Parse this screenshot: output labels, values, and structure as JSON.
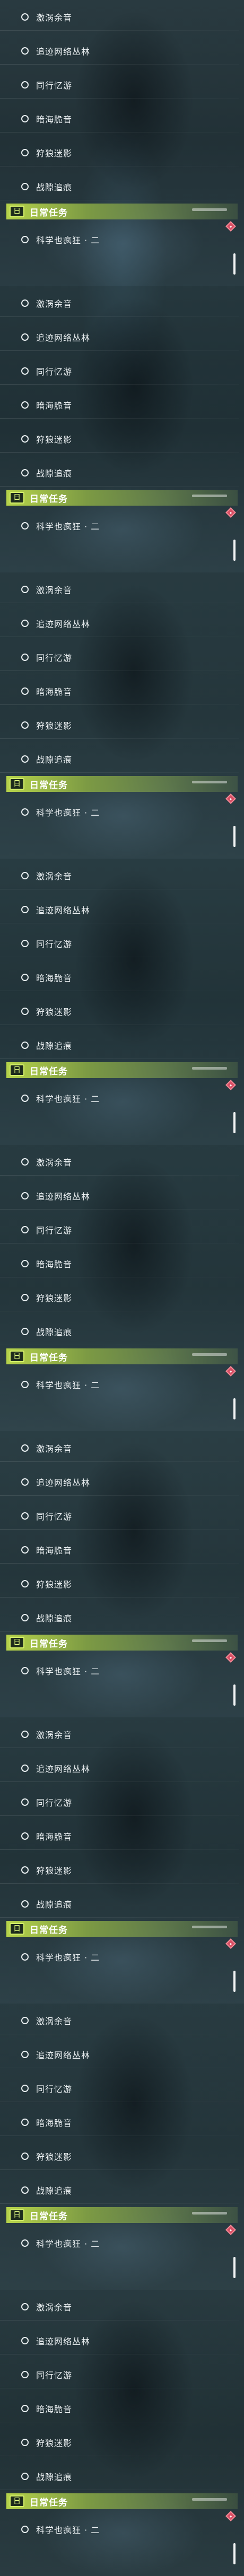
{
  "panels": [
    {
      "tasks": [
        "激涡余音",
        "追迹网络丛林",
        "同行忆游",
        "暗海脆音",
        "狩狼迷影",
        "战隙追痕"
      ],
      "section": {
        "icon_text": "日",
        "title": "日常任务"
      },
      "daily": {
        "text": "科学也疯狂 · 二"
      }
    },
    {
      "tasks": [
        "激涡余音",
        "追迹网络丛林",
        "同行忆游",
        "暗海脆音",
        "狩狼迷影",
        "战隙追痕"
      ],
      "section": {
        "icon_text": "日",
        "title": "日常任务"
      },
      "daily": {
        "text": "科学也疯狂 · 二"
      }
    },
    {
      "tasks": [
        "激涡余音",
        "追迹网络丛林",
        "同行忆游",
        "暗海脆音",
        "狩狼迷影",
        "战隙追痕"
      ],
      "section": {
        "icon_text": "日",
        "title": "日常任务"
      },
      "daily": {
        "text": "科学也疯狂 · 二"
      }
    },
    {
      "tasks": [
        "激涡余音",
        "追迹网络丛林",
        "同行忆游",
        "暗海脆音",
        "狩狼迷影",
        "战隙追痕"
      ],
      "section": {
        "icon_text": "日",
        "title": "日常任务"
      },
      "daily": {
        "text": "科学也疯狂 · 二"
      }
    },
    {
      "tasks": [
        "激涡余音",
        "追迹网络丛林",
        "同行忆游",
        "暗海脆音",
        "狩狼迷影",
        "战隙追痕"
      ],
      "section": {
        "icon_text": "日",
        "title": "日常任务"
      },
      "daily": {
        "text": "科学也疯狂 · 二"
      }
    },
    {
      "tasks": [
        "激涡余音",
        "追迹网络丛林",
        "同行忆游",
        "暗海脆音",
        "狩狼迷影",
        "战隙追痕"
      ],
      "section": {
        "icon_text": "日",
        "title": "日常任务"
      },
      "daily": {
        "text": "科学也疯狂 · 二"
      }
    },
    {
      "tasks": [
        "激涡余音",
        "追迹网络丛林",
        "同行忆游",
        "暗海脆音",
        "狩狼迷影",
        "战隙追痕"
      ],
      "section": {
        "icon_text": "日",
        "title": "日常任务"
      },
      "daily": {
        "text": "科学也疯狂 · 二"
      }
    },
    {
      "tasks": [
        "激涡余音",
        "追迹网络丛林",
        "同行忆游",
        "暗海脆音",
        "狩狼迷影",
        "战隙追痕"
      ],
      "section": {
        "icon_text": "日",
        "title": "日常任务"
      },
      "daily": {
        "text": "科学也疯狂 · 二"
      }
    },
    {
      "tasks": [
        "激涡余音",
        "追迹网络丛林",
        "同行忆游",
        "暗海脆音",
        "狩狼迷影",
        "战隙追痕"
      ],
      "section": {
        "icon_text": "日",
        "title": "日常任务"
      },
      "daily": {
        "text": "科学也疯狂 · 二"
      }
    }
  ],
  "colors": {
    "header_accent": "#b6d34a",
    "marker": "#d84e64",
    "text": "#e9eef0"
  },
  "icons": {
    "task_status": "circle-outline-icon",
    "section": "daily-calendar-icon",
    "tracking": "red-diamond-marker-icon"
  }
}
